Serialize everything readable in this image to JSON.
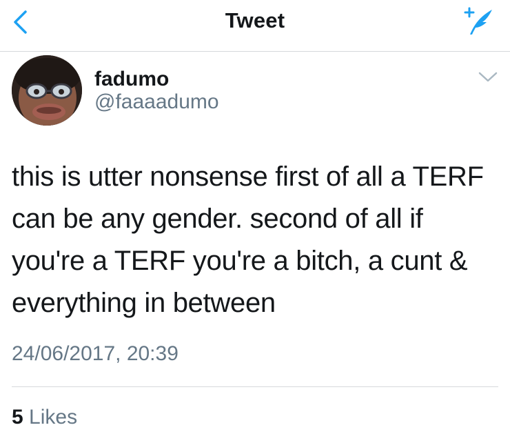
{
  "header": {
    "title": "Tweet",
    "back_icon": "chevron-left-icon",
    "compose_icon": "compose-tweet-icon",
    "accent_color": "#1da1f2"
  },
  "tweet": {
    "author": {
      "display_name": "fadumo",
      "handle": "@faaaadumo"
    },
    "text": "this is utter nonsense first of all a TERF can be any gender. second of all if you're a TERF you're a bitch, a cunt & everything in between",
    "timestamp": "24/06/2017, 20:39",
    "likes_count": "5",
    "likes_label": "Likes"
  }
}
